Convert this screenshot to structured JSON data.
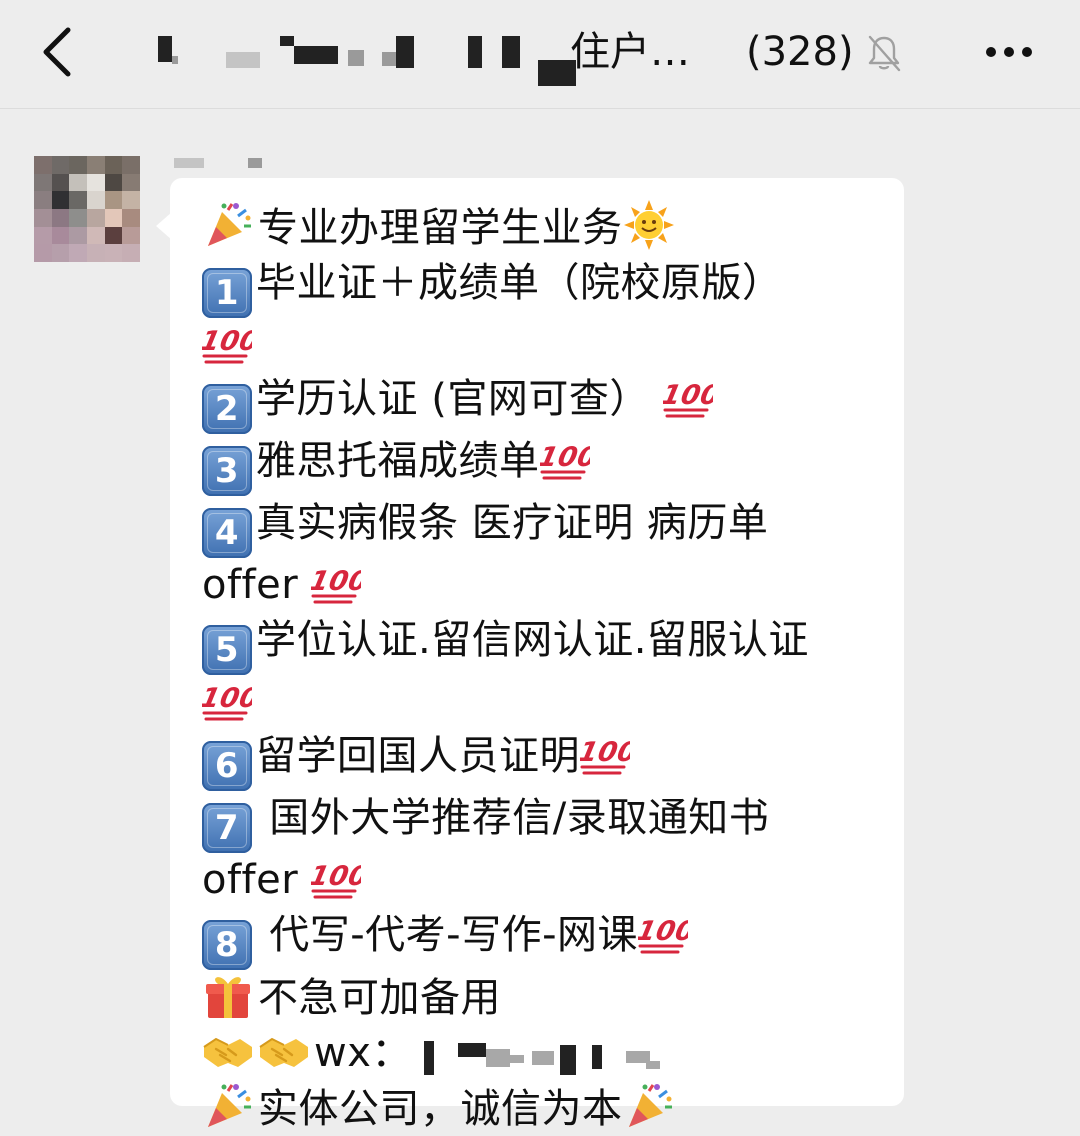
{
  "navbar": {
    "back_icon": "chevron-left-icon",
    "title_visible": "住户…",
    "member_count": "(328)",
    "mute_icon": "bell-slash-icon",
    "more_icon": "ellipsis-icon"
  },
  "message": {
    "sender_name_redacted": true,
    "lines": [
      {
        "prefix_emoji": "party-popper",
        "text": "专业办理留学生业务",
        "suffix_emoji": "sun-with-face"
      },
      {
        "keycap": "1",
        "text": "毕业证＋成绩单（院校原版）"
      },
      {
        "hundred": true
      },
      {
        "keycap": "2",
        "text": "学历认证 (官网可查） ",
        "suffix_hundred": true
      },
      {
        "keycap": "3",
        "text": "雅思托福成绩单",
        "suffix_hundred": true
      },
      {
        "keycap": "4",
        "text": "真实病假条 医疗证明 病历单"
      },
      {
        "text": "offer ",
        "suffix_hundred": true
      },
      {
        "keycap": "5",
        "text": "学位认证.留信网认证.留服认证"
      },
      {
        "hundred": true
      },
      {
        "keycap": "6",
        "text": "留学回国人员证明",
        "suffix_hundred": true
      },
      {
        "keycap": "7",
        "text": " 国外大学推荐信/录取通知书"
      },
      {
        "text": "offer ",
        "suffix_hundred": true
      },
      {
        "keycap": "8",
        "text": " 代写-代考-写作-网课",
        "suffix_hundred": true
      },
      {
        "prefix_emoji": "gift",
        "text": "不急可加备用"
      },
      {
        "prefix_emoji": "handshake",
        "prefix_emoji2": "handshake",
        "text": "wx：",
        "redacted_tail": true
      },
      {
        "prefix_emoji": "party-popper",
        "text": "实体公司，诚信为本",
        "suffix_emoji": "party-popper"
      }
    ]
  },
  "colors": {
    "background": "#ededed",
    "bubble": "#ffffff",
    "text": "#111111",
    "hundred_red": "#d7263d",
    "keycap_blue": "#4a78b8"
  }
}
